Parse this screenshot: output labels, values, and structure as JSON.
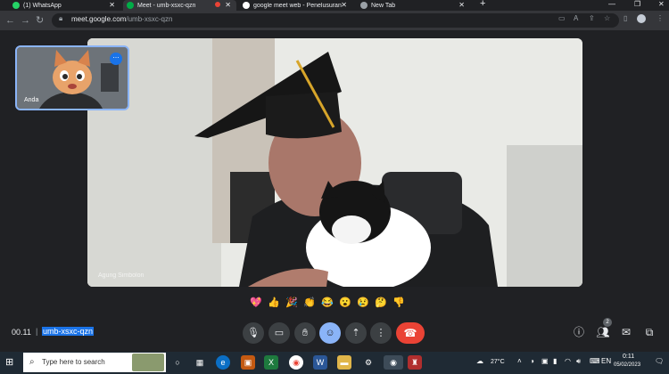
{
  "browser": {
    "tabs": [
      {
        "title": "(1) WhatsApp",
        "active": false
      },
      {
        "title": "Meet - umb-xsxc-qzn",
        "active": true
      },
      {
        "title": "google meet web - Penelusuran G",
        "active": false
      },
      {
        "title": "New Tab",
        "active": false
      }
    ],
    "url_host": "meet.google.com",
    "url_path": "/umb-xsxc-qzn"
  },
  "meet": {
    "self_name": "Anda",
    "main_participant_name": "Agung Simbolon",
    "reactions": [
      "💖",
      "👍",
      "🎉",
      "👏",
      "😂",
      "😮",
      "😢",
      "🤔",
      "👎"
    ],
    "time": "00.11",
    "meeting_code": "umb-xsxc-qzn",
    "people_count": "2",
    "colors": {
      "accent": "#8ab4f8",
      "end_call": "#ea4335",
      "code_highlight": "#1a73e8"
    }
  },
  "taskbar": {
    "search_placeholder": "Type here to search",
    "temperature": "27°C",
    "clock_time": "0:11",
    "clock_date": "05/02/2023"
  }
}
